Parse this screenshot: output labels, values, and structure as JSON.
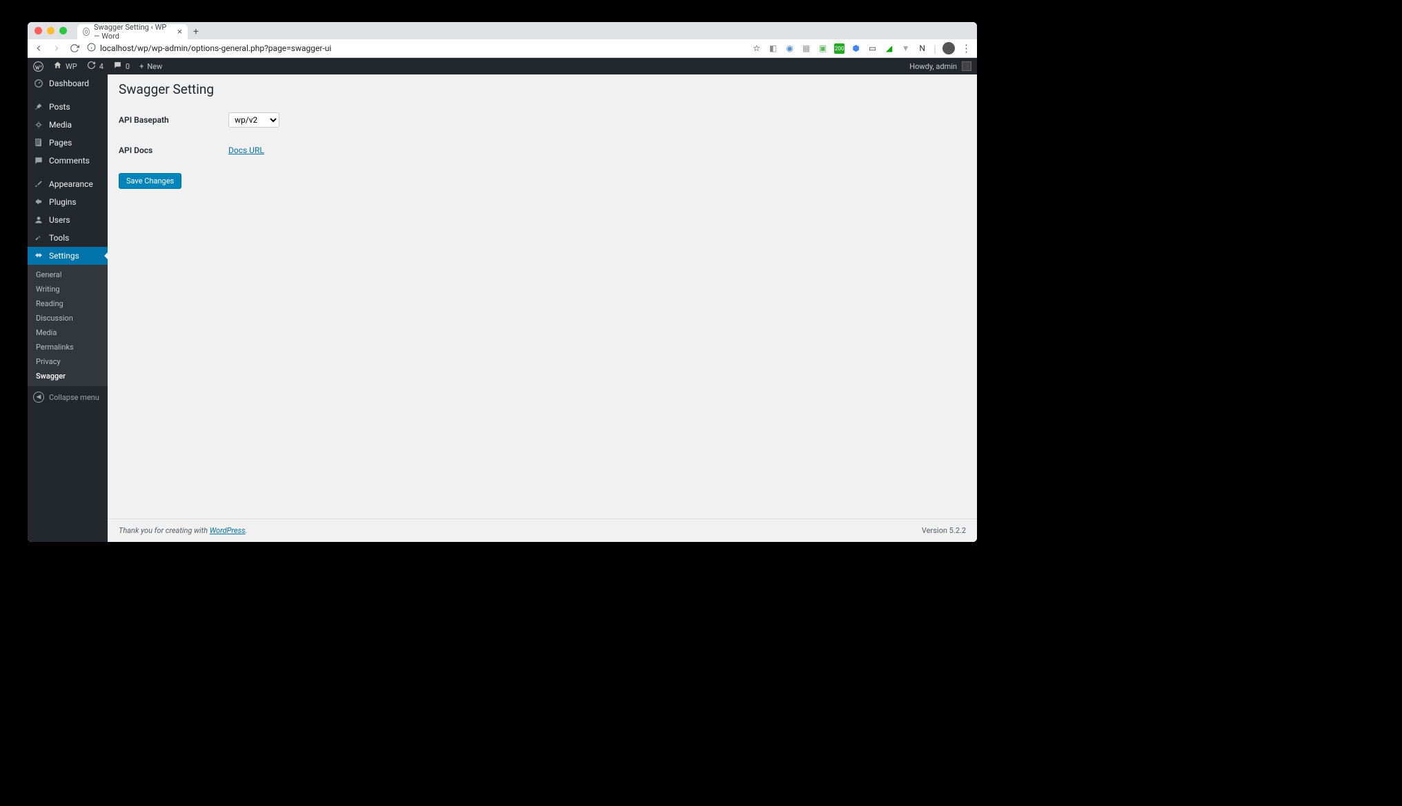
{
  "browser": {
    "tab_title": "Swagger Setting ‹ WP — Word",
    "url": "localhost/wp/wp-admin/options-general.php?page=swagger-ui"
  },
  "adminbar": {
    "site_name": "WP",
    "update_count": "4",
    "comment_count": "0",
    "new_label": "New",
    "greeting": "Howdy, admin"
  },
  "sidebar": {
    "items": [
      {
        "label": "Dashboard"
      },
      {
        "label": "Posts"
      },
      {
        "label": "Media"
      },
      {
        "label": "Pages"
      },
      {
        "label": "Comments"
      },
      {
        "label": "Appearance"
      },
      {
        "label": "Plugins"
      },
      {
        "label": "Users"
      },
      {
        "label": "Tools"
      },
      {
        "label": "Settings"
      }
    ],
    "submenu": [
      {
        "label": "General"
      },
      {
        "label": "Writing"
      },
      {
        "label": "Reading"
      },
      {
        "label": "Discussion"
      },
      {
        "label": "Media"
      },
      {
        "label": "Permalinks"
      },
      {
        "label": "Privacy"
      },
      {
        "label": "Swagger"
      }
    ],
    "collapse_label": "Collapse menu"
  },
  "page": {
    "title": "Swagger Setting",
    "api_basepath_label": "API Basepath",
    "api_basepath_value": "wp/v2",
    "api_docs_label": "API Docs",
    "docs_link_text": "Docs URL",
    "save_button": "Save Changes"
  },
  "footer": {
    "thanks_prefix": "Thank you for creating with ",
    "wp_link": "WordPress",
    "thanks_suffix": ".",
    "version": "Version 5.2.2"
  }
}
